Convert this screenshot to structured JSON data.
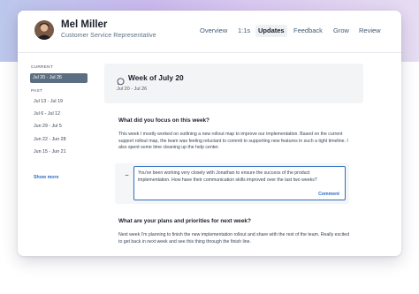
{
  "header": {
    "user_name": "Mel Miller",
    "user_role": "Customer Service Representative",
    "tabs": [
      "Overview",
      "1:1s",
      "Updates",
      "Feedback",
      "Grow",
      "Review"
    ],
    "active_tab": "Updates"
  },
  "sidebar": {
    "current_label": "CURRENT",
    "current_week": "Jul 20 - Jul 26",
    "past_label": "PAST",
    "past_weeks": [
      "Jul 13 - Jul 19",
      "Jul 6 - Jul 12",
      "Jun 29 - Jul 5",
      "Jun 22 - Jun 28",
      "Jun 15 - Jun 21"
    ],
    "show_more": "Show more"
  },
  "main": {
    "week_title": "Week of July 20",
    "week_range": "Jul 20 - Jul 26",
    "q1": "What did you focus on this week?",
    "a1": "This week I mostly worked on outlining a new rollout map to improve our implementation. Based on the current support rollout map, the team was feeling reluctant to commit to supporting new features in such a tight timeline. I also spent some time cleaning up the help center.",
    "comment_text": "You've been working very closely with Jonathan to ensure the success of the product implementation. How have their communication skills improved over the last two weeks?",
    "comment_button": "Comment",
    "q2": "What are your plans and priorities for next week?",
    "a2": "Next week I'm planning to finish the new implementation rollout and share with the rest of the team. Really excited to get back in next week and see this thing through the finish line."
  },
  "colors": {
    "accent": "#2f6ec2",
    "selected_week_bg": "#5c6f82",
    "banner_bg": "#f3f4f6"
  }
}
